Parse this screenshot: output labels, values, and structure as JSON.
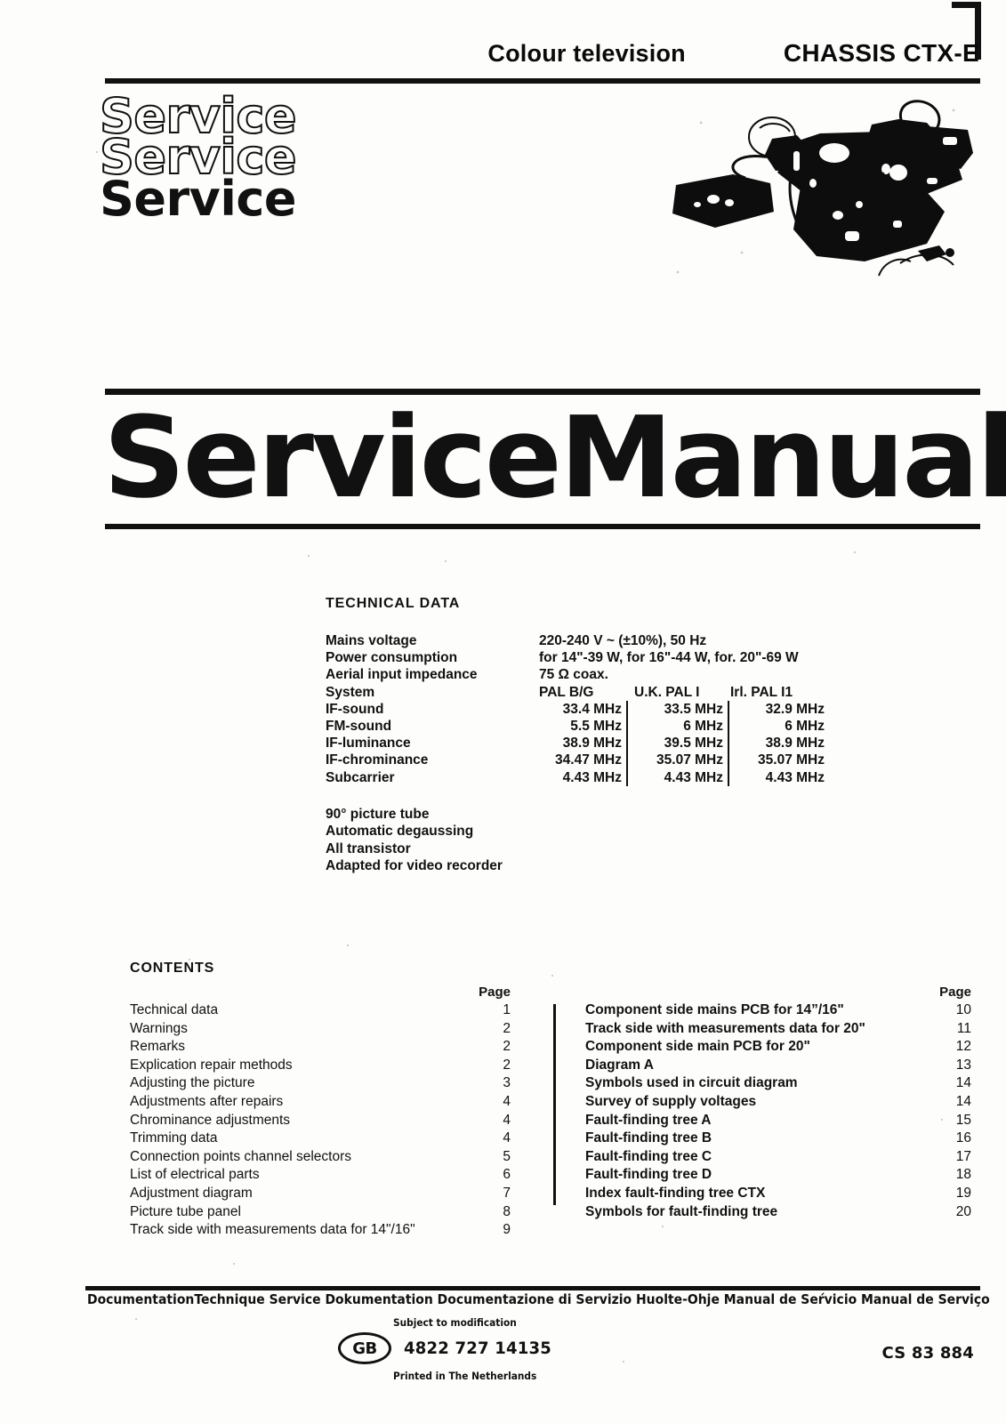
{
  "header": {
    "title": "Colour television",
    "chassis": "CHASSIS CTX-E"
  },
  "logo": {
    "line1": "Service",
    "line2": "Service",
    "line3": "Service"
  },
  "big_title": "ServiceManual",
  "technical": {
    "heading": "TECHNICAL DATA",
    "rows": [
      {
        "label": "Mains voltage",
        "value": "220-240 V ~ (±10%), 50 Hz"
      },
      {
        "label": "Power consumption",
        "value": "for 14\"-39 W, for 16\"-44 W, for. 20\"-69 W"
      },
      {
        "label": "Aerial input impedance",
        "value": "75 Ω coax."
      }
    ],
    "table": {
      "header_label": "System",
      "columns": [
        "PAL B/G",
        "U.K. PAL I",
        "Irl. PAL I1"
      ],
      "rows": [
        {
          "label": "IF-sound",
          "values": [
            "33.4 MHz",
            "33.5 MHz",
            "32.9 MHz"
          ]
        },
        {
          "label": "FM-sound",
          "values": [
            "5.5 MHz",
            "6   MHz",
            "6   MHz"
          ]
        },
        {
          "label": "IF-luminance",
          "values": [
            "38.9 MHz",
            "39.5 MHz",
            "38.9 MHz"
          ]
        },
        {
          "label": "IF-chrominance",
          "values": [
            "34.47 MHz",
            "35.07 MHz",
            "35.07 MHz"
          ]
        },
        {
          "label": "Subcarrier",
          "values": [
            "4.43 MHz",
            "4.43 MHz",
            "4.43 MHz"
          ]
        }
      ]
    },
    "features": [
      "90° picture tube",
      "Automatic degaussing",
      "All transistor",
      "Adapted for video recorder"
    ]
  },
  "contents": {
    "heading": "CONTENTS",
    "page_header": "Page",
    "left": [
      {
        "title": "Technical data",
        "page": "1"
      },
      {
        "title": "Warnings",
        "page": "2"
      },
      {
        "title": "Remarks",
        "page": "2"
      },
      {
        "title": "Explication repair methods",
        "page": "2"
      },
      {
        "title": "Adjusting the picture",
        "page": "3"
      },
      {
        "title": "Adjustments after repairs",
        "page": "4"
      },
      {
        "title": "Chrominance adjustments",
        "page": "4"
      },
      {
        "title": "Trimming data",
        "page": "4"
      },
      {
        "title": "Connection points channel selectors",
        "page": "5"
      },
      {
        "title": "List of electrical parts",
        "page": "6"
      },
      {
        "title": "Adjustment diagram",
        "page": "7"
      },
      {
        "title": "Picture tube panel",
        "page": "8"
      },
      {
        "title": "Track side with measurements data for 14\"/16\"",
        "page": "9"
      }
    ],
    "right": [
      {
        "title": "Component side mains PCB for 14”/16\"",
        "page": "10"
      },
      {
        "title": "Track side with measurements data for 20\"",
        "page": "11"
      },
      {
        "title": "Component side main PCB for 20\"",
        "page": "12"
      },
      {
        "title": "Diagram A",
        "page": "13"
      },
      {
        "title": "Symbols used in circuit diagram",
        "page": "14"
      },
      {
        "title": "Survey of supply voltages",
        "page": "14"
      },
      {
        "title": "Fault-finding tree A",
        "page": "15"
      },
      {
        "title": "Fault-finding tree B",
        "page": "16"
      },
      {
        "title": "Fault-finding tree C",
        "page": "17"
      },
      {
        "title": "Fault-finding tree D",
        "page": "18"
      },
      {
        "title": "Index fault-finding tree CTX",
        "page": "19"
      },
      {
        "title": "Symbols for fault-finding tree",
        "page": "20"
      }
    ]
  },
  "footer": {
    "languages": "DocumentationTechnique Service Dokumentation Documentazione di Servizio Huolte-Ohje Manual de Seŕvicio Manual de Serviço",
    "subject_to_modification": "Subject to modification",
    "country_code": "GB",
    "part_number": "4822 727 14135",
    "printed_in": "Printed in The Netherlands",
    "cs_code": "CS 83 884"
  }
}
